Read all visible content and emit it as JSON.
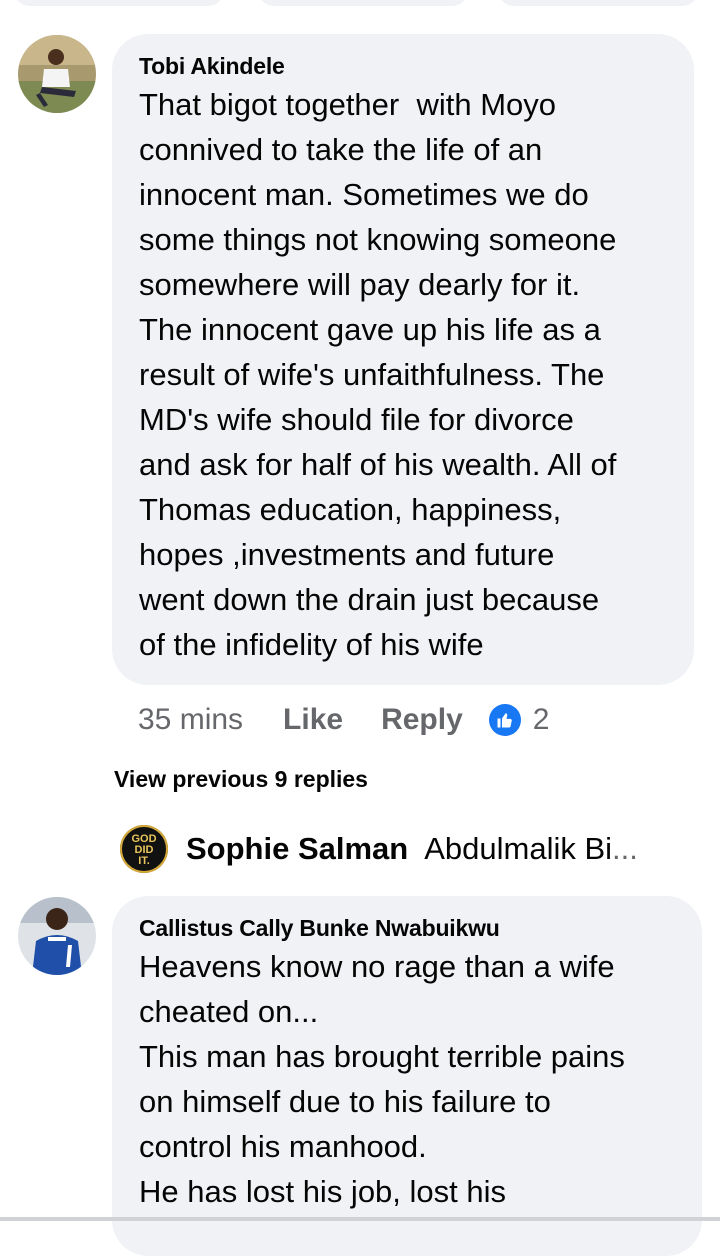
{
  "comment1": {
    "author": "Tobi Akindele",
    "lines": [
      "That bigot together  with Moyo",
      "connived to take the life of an",
      "innocent man. Sometimes we do",
      "some things not knowing someone",
      "somewhere will pay dearly for it.",
      "The innocent gave up his life as a",
      "result of wife's unfaithfulness. The",
      "MD's wife should file for divorce",
      "and ask for half of his wealth. All of",
      "Thomas education, happiness,",
      "hopes ,investments and future",
      "went down the drain just because",
      "of the infidelity of his wife"
    ],
    "time": "35 mins",
    "like_label": "Like",
    "reply_label": "Reply",
    "reaction_count": "2",
    "reaction_icon": "thumbs-up-icon"
  },
  "view_previous": "View previous 9 replies",
  "latest_reply": {
    "badge_text": [
      "GOD",
      "DID",
      "IT."
    ],
    "author": "Sophie Salman",
    "preview": "Abdulmalik Bi",
    "ellipsis": "..."
  },
  "comment2": {
    "author": "Callistus Cally Bunke Nwabuikwu",
    "lines": [
      "Heavens know no rage than a wife",
      "cheated on...",
      "This man has brought terrible pains",
      "on himself due to his failure to",
      "control his manhood.",
      "He has lost his job, lost his"
    ]
  },
  "colors": {
    "bubble": "#f0f2f5",
    "meta_text": "#65676b",
    "like_blue": "#1877f2"
  }
}
